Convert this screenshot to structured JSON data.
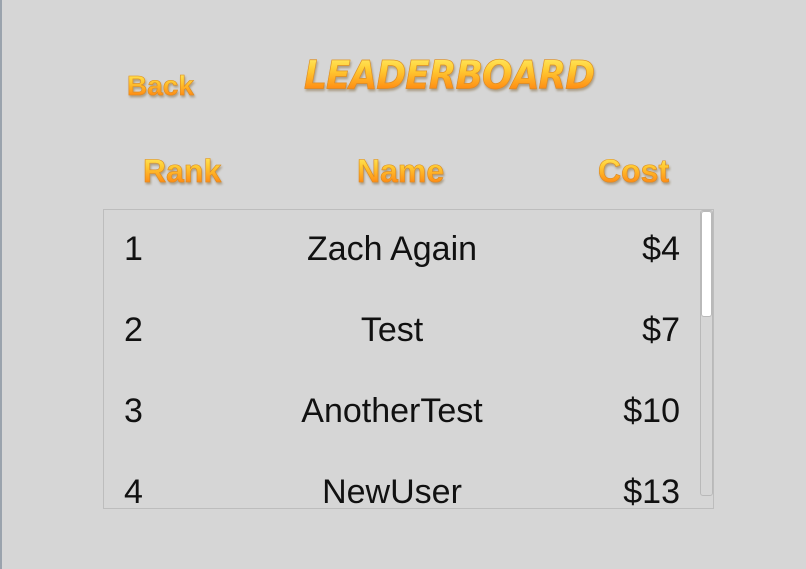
{
  "nav": {
    "back_label": "Back",
    "title": "LEADERBOARD"
  },
  "headers": {
    "rank": "Rank",
    "name": "Name",
    "cost": "Cost"
  },
  "rows": [
    {
      "rank": "1",
      "name": "Zach Again",
      "cost": "$4"
    },
    {
      "rank": "2",
      "name": "Test",
      "cost": "$7"
    },
    {
      "rank": "3",
      "name": "AnotherTest",
      "cost": "$10"
    },
    {
      "rank": "4",
      "name": "NewUser",
      "cost": "$13"
    }
  ],
  "colors": {
    "background": "#d6d6d6",
    "gold_top": "#fff06a",
    "gold_bottom": "#ff6a00",
    "row_text": "#111111"
  }
}
